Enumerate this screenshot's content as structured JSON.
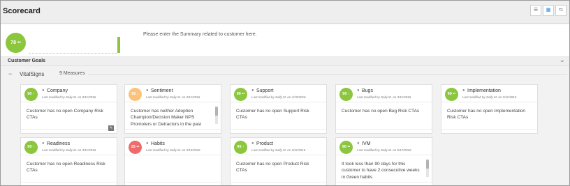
{
  "header": {
    "title": "Scorecard",
    "view_buttons": [
      "list-view",
      "grid-view",
      "compact-view"
    ]
  },
  "summary": {
    "overall_score": "78 ••",
    "placeholder": "Please enter the Summary related to customer here."
  },
  "goals": {
    "title": "Customer Goals"
  },
  "group": {
    "title": "VitalSigns",
    "measures": "9 Measures"
  },
  "colors": {
    "green": "#8cc63f",
    "orange": "#fbc37a",
    "red": "#ef6b6b"
  },
  "cards": [
    {
      "name": "Company",
      "score": "90 ↑",
      "color": "#8cc63f",
      "modified": "Last modified by Sally M. on 3/11/2016",
      "text": "Customer has no open Company Risk CTAs",
      "scroll": false,
      "edit": true
    },
    {
      "name": "Sentiment",
      "score": "55 ↓",
      "color": "#fbc37a",
      "modified": "Last modified by Sally M. on 3/11/2016",
      "text": "Customer has neither Adoption Champion/Decision Maker NPS Promoters or Detractors in the past",
      "scroll": true,
      "edit": false
    },
    {
      "name": "Support",
      "score": "90 ••",
      "color": "#8cc63f",
      "modified": "Last modified by Sally M. on 4/15/2016",
      "text": "Customer has no open Support Risk CTAs",
      "scroll": false,
      "edit": false
    },
    {
      "name": "Bugs",
      "score": "90 ↑",
      "color": "#8cc63f",
      "modified": "Last modified by Sally M. on 3/11/2016",
      "text": "Customer has no open Bug Risk CTAs",
      "scroll": false,
      "edit": false
    },
    {
      "name": "Implementation",
      "score": "90 ••",
      "color": "#8cc63f",
      "modified": "Last modified by Sally M. on 3/11/2016",
      "text": "Customer has no open Implementation Risk CTAs",
      "scroll": false,
      "edit": false
    },
    {
      "name": "Readiness",
      "score": "90 ↑",
      "color": "#8cc63f",
      "modified": "Last modified by Sally M. on 3/11/2016",
      "text": "Customer has no open Readiness Risk CTAs",
      "scroll": false,
      "edit": false
    },
    {
      "name": "Habits",
      "score": "25 ••",
      "color": "#ef6b6b",
      "modified": "Last modified by Sally M. on 3/15/2016",
      "text": "",
      "scroll": false,
      "edit": false
    },
    {
      "name": "Product",
      "score": "90 ↑",
      "color": "#8cc63f",
      "modified": "Last modified by Sally M. on 3/11/2016",
      "text": "Customer has no open Product Risk CTAs",
      "scroll": false,
      "edit": false
    },
    {
      "name": "IVM",
      "score": "90 ••",
      "color": "#8cc63f",
      "modified": "Last modified by Sally M. on 5/17/2016",
      "text": "It took less than 90 days for this customer to have 2 consecutive weeks in Green habits",
      "scroll": true,
      "edit": false
    }
  ]
}
